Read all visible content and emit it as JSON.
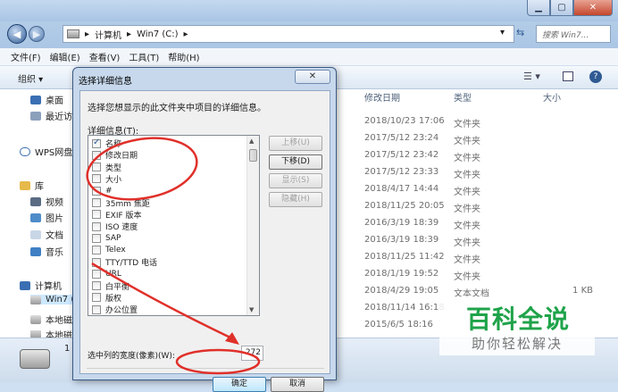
{
  "caption": {
    "min": "▁",
    "max": "▢",
    "close": "✕"
  },
  "address": {
    "parts": [
      "计算机",
      "Win7 (C:)"
    ],
    "sep": "▸"
  },
  "search": {
    "placeholder": "搜索 Win7..."
  },
  "menu": [
    "文件(F)",
    "编辑(E)",
    "查看(V)",
    "工具(T)",
    "帮助(H)"
  ],
  "toolbar": {
    "organize": "组织 ▾"
  },
  "nav": {
    "desktop": "桌面",
    "recent": "最近访",
    "wps": "WPS网盘",
    "library": "库",
    "video": "视频",
    "pictures": "图片",
    "docs": "文档",
    "music": "音乐",
    "computer": "计算机",
    "win7": "Win7 (",
    "localdisk": "本地磁",
    "localdisk2": "本地磁"
  },
  "columns": {
    "date": "修改日期",
    "type": "类型",
    "size": "大小"
  },
  "files": [
    {
      "date": "2018/10/23 17:06",
      "type": "文件夹",
      "size": ""
    },
    {
      "date": "2017/5/12 23:24",
      "type": "文件夹",
      "size": ""
    },
    {
      "date": "2017/5/12 23:42",
      "type": "文件夹",
      "size": ""
    },
    {
      "date": "2017/5/12 23:33",
      "type": "文件夹",
      "size": ""
    },
    {
      "date": "2018/4/17 14:44",
      "type": "文件夹",
      "size": ""
    },
    {
      "date": "2018/11/25 20:05",
      "type": "文件夹",
      "size": ""
    },
    {
      "date": "2016/3/19 18:39",
      "type": "文件夹",
      "size": ""
    },
    {
      "date": "2016/3/19 18:39",
      "type": "文件夹",
      "size": ""
    },
    {
      "date": "2018/11/25 11:42",
      "type": "文件夹",
      "size": ""
    },
    {
      "date": "2018/1/19 19:52",
      "type": "文件夹",
      "size": ""
    },
    {
      "date": "2018/4/29 19:05",
      "type": "文本文档",
      "size": "1 KB"
    },
    {
      "date": "2018/11/14 16:18",
      "type": "",
      "size": ""
    },
    {
      "date": "2015/6/5 18:16",
      "type": "",
      "size": ""
    }
  ],
  "status": {
    "count": "1"
  },
  "dialog": {
    "title": "选择详细信息",
    "close": "✕",
    "description": "选择您想显示的此文件夹中项目的详细信息。",
    "details_label": "详细信息(T):",
    "items": [
      {
        "label": "名称",
        "checked": true
      },
      {
        "label": "修改日期",
        "checked": false
      },
      {
        "label": "类型",
        "checked": false
      },
      {
        "label": "大小",
        "checked": false
      },
      {
        "label": "#",
        "checked": false
      },
      {
        "label": "35mm 焦距",
        "checked": false
      },
      {
        "label": "EXIF 版本",
        "checked": false
      },
      {
        "label": "ISO 速度",
        "checked": false
      },
      {
        "label": "SAP",
        "checked": false
      },
      {
        "label": "Telex",
        "checked": false
      },
      {
        "label": "TTY/TTD 电话",
        "checked": false
      },
      {
        "label": "URL",
        "checked": false
      },
      {
        "label": "白平衡",
        "checked": false
      },
      {
        "label": "版权",
        "checked": false
      },
      {
        "label": "办公位置",
        "checked": false
      }
    ],
    "move_up": "上移(U)",
    "move_down": "下移(D)",
    "show": "显示(S)",
    "hide": "隐藏(H)",
    "width_label": "选中列的宽度(像素)(W):",
    "width_value": "272",
    "ok": "确定",
    "cancel": "取消"
  },
  "watermark": {
    "title": "百科全说",
    "subtitle": "助你轻松解决"
  },
  "colors": {
    "annotation": "#e0302a",
    "watermark_green": "#1fa34a"
  }
}
